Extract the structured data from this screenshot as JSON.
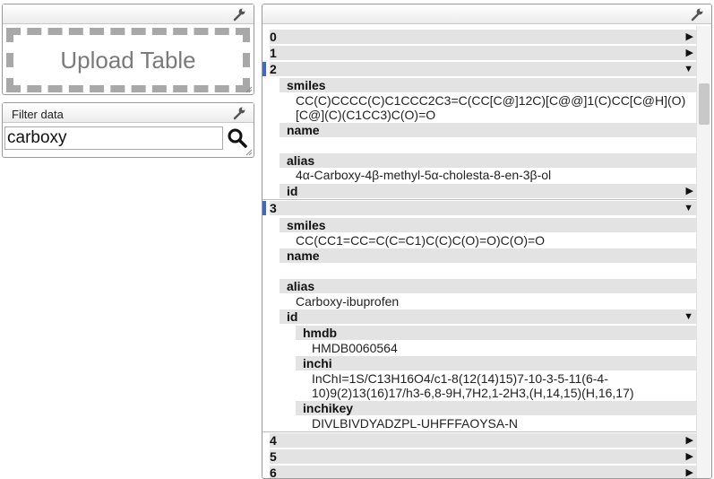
{
  "upload": {
    "label": "Upload Table"
  },
  "filter": {
    "title": "Filter data",
    "query": "carboxy"
  },
  "results": {
    "collapsed_top": [
      "0",
      "1"
    ],
    "record2": {
      "index": "2",
      "smiles_key": "smiles",
      "smiles_line1": "CC(C)CCCC(C)C1CCC2C3=C(CC[C@]12C)[C@@]1(C)CC[C@H](O)",
      "smiles_line2": "[C@](C)(C1CC3)C(O)=O",
      "name_key": "name",
      "name_value": "",
      "alias_key": "alias",
      "alias_value": "4α-Carboxy-4β-methyl-5α-cholesta-8-en-3β-ol",
      "id_key": "id"
    },
    "record3": {
      "index": "3",
      "smiles_key": "smiles",
      "smiles_value": "CC(CC1=CC=C(C=C1)C(C)C(O)=O)C(O)=O",
      "name_key": "name",
      "name_value": "",
      "alias_key": "alias",
      "alias_value": "Carboxy-ibuprofen",
      "id_key": "id",
      "hmdb_key": "hmdb",
      "hmdb_value": "HMDB0060564",
      "inchi_key_label": "inchi",
      "inchi_line1": "InChI=1S/C13H16O4/c1-8(12(14)15)7-10-3-5-11(6-4-",
      "inchi_line2": "10)9(2)13(16)17/h3-6,8-9H,7H2,1-2H3,(H,14,15)(H,16,17)",
      "inchikey_label": "inchikey",
      "inchikey_value": "DIVLBIVDYADZPL-UHFFFAOYSA-N"
    },
    "collapsed_bottom": [
      "4",
      "5",
      "6"
    ]
  },
  "colors": {
    "selection_bar": "#4466cc",
    "row_bg": "#e3e3e3"
  },
  "icons": {
    "panel_settings": "wrench-icon",
    "search": "magnifier-icon",
    "expand": "triangle-right",
    "collapse": "triangle-down"
  }
}
